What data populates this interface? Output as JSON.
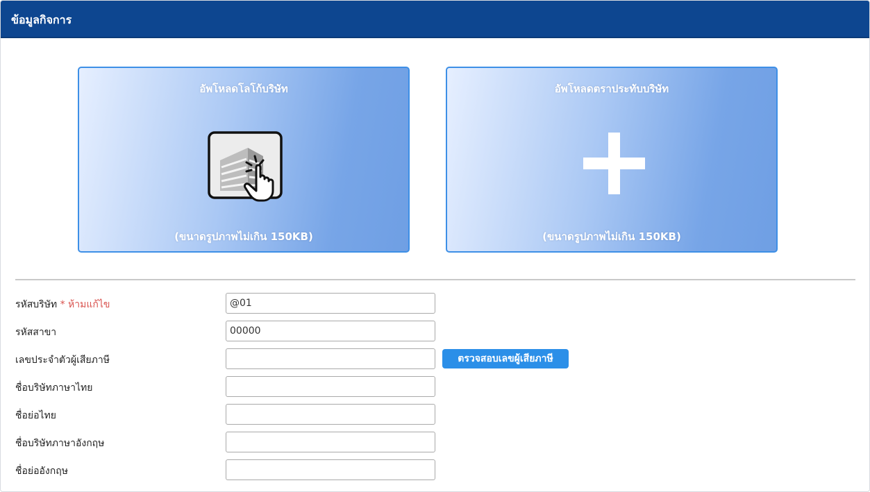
{
  "header": {
    "title": "ข้อมูลกิจการ",
    "bg_color": "#0d4690"
  },
  "upload": {
    "logo": {
      "title": "อัพโหลดโลโก้บริษัท",
      "note": "(ขนาดรูปภาพไม่เกิน 150KB)",
      "icon": "building-click-icon"
    },
    "seal": {
      "title": "อัพโหลดตราประทับบริษัท",
      "note": "(ขนาดรูปภาพไม่เกิน 150KB)",
      "icon": "plus-icon"
    }
  },
  "form": {
    "company_code": {
      "label": "รหัสบริษัท",
      "required_note": "* ห้ามแก้ไข",
      "value": "@01"
    },
    "branch_code": {
      "label": "รหัสสาขา",
      "value": "00000"
    },
    "tax_id": {
      "label": "เลขประจำตัวผู้เสียภาษี",
      "value": "",
      "verify_button": "ตรวจสอบเลขผู้เสียภาษี"
    },
    "company_name_th": {
      "label": "ชื่อบริษัทภาษาไทย",
      "value": ""
    },
    "short_name_th": {
      "label": "ชื่อย่อไทย",
      "value": ""
    },
    "company_name_en": {
      "label": "ชื่อบริษัทภาษาอังกฤษ",
      "value": ""
    },
    "short_name_en": {
      "label": "ชื่อย่ออังกฤษ",
      "value": ""
    }
  },
  "colors": {
    "accent": "#2b8fe8",
    "required": "#d9534f"
  }
}
